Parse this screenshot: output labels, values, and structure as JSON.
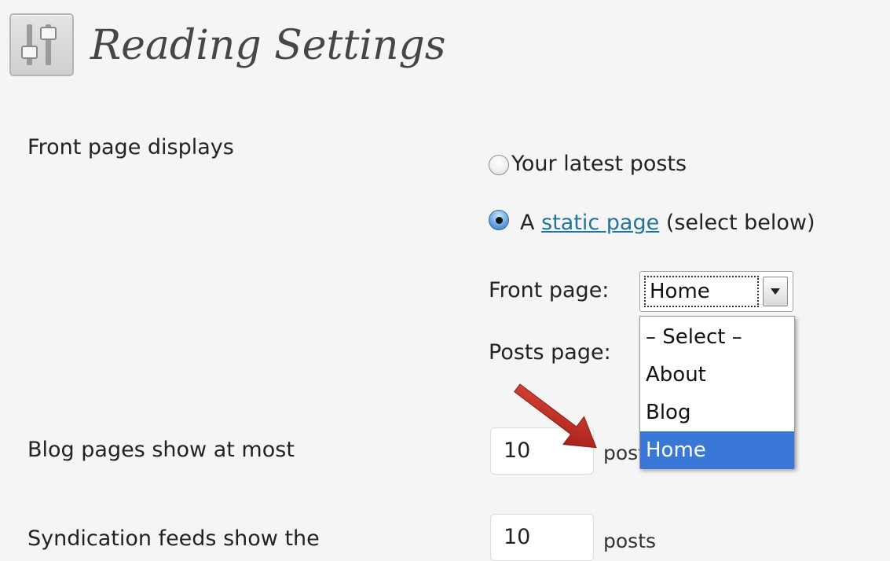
{
  "header": {
    "title": "Reading Settings",
    "icon": "settings-sliders-icon"
  },
  "front_page_displays": {
    "label": "Front page displays",
    "options": [
      {
        "label": "Your latest posts",
        "checked": false
      },
      {
        "prefix": "A",
        "link_text": "static page",
        "suffix": "(select below)",
        "checked": true
      }
    ],
    "front_page": {
      "label": "Front page:",
      "value": "Home",
      "options": [
        "– Select –",
        "About",
        "Blog",
        "Home"
      ],
      "highlighted": "Home"
    },
    "posts_page": {
      "label": "Posts page:"
    }
  },
  "blog_pages": {
    "label": "Blog pages show at most",
    "value": "10",
    "suffix": "posts"
  },
  "syndication": {
    "label": "Syndication feeds show the",
    "value": "10",
    "suffix": "posts"
  },
  "annotation": {
    "arrow": "red-arrow-icon",
    "color": "#c0251c"
  },
  "colors": {
    "background": "#f5f5f5",
    "link": "#21759b",
    "highlight": "#3a78d8"
  }
}
